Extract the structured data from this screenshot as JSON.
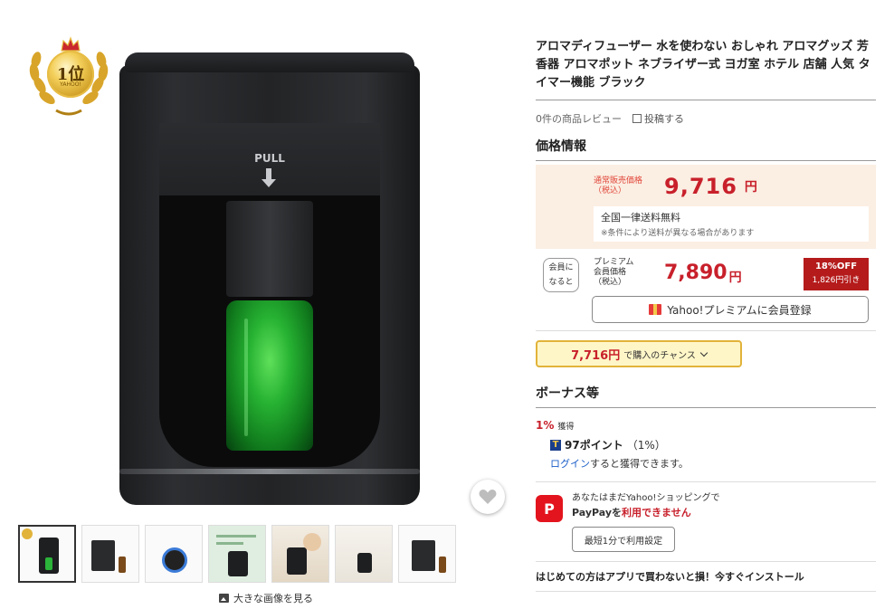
{
  "badge": {
    "rank": "1位",
    "brand": "YAHOO!"
  },
  "product_image": {
    "pull_label": "PULL"
  },
  "thumbnails": [
    "thumb-1",
    "thumb-2",
    "thumb-3",
    "thumb-4",
    "thumb-5",
    "thumb-6",
    "thumb-7"
  ],
  "large_image_link": "大きな画像を見る",
  "product": {
    "title": "アロマディフューザー 水を使わない おしゃれ アロマグッズ 芳香器 アロマポット ネブライザー式 ヨガ室 ホテル 店舗 人気 タイマー機能 ブラック",
    "review_count": "0件の商品レビュー",
    "post_review": "投稿する"
  },
  "price": {
    "section_title": "価格情報",
    "regular_label_1": "通常販売価格",
    "regular_label_2": "（税込）",
    "regular_price": "9,716",
    "yen": "円",
    "shipping_main": "全国一律送料無料",
    "shipping_note": "※条件により送料が異なる場合があります",
    "member_tag_1": "会員に",
    "member_tag_2": "なると",
    "premium_label_1": "プレミアム",
    "premium_label_2": "会員価格",
    "premium_label_3": "（税込）",
    "premium_price": "7,890",
    "premium_yen": "円",
    "off_percent": "18%OFF",
    "off_amount": "1,826円引き",
    "premium_button": "Yahoo!プレミアムに会員登録",
    "chance_price": "7,716円",
    "chance_text": "で購入のチャンス"
  },
  "bonus": {
    "section_title": "ボーナス等",
    "percent": "1%",
    "percent_label": "獲得",
    "t_icon": "T",
    "points": "97ポイント",
    "points_rate": "（1%）",
    "login_link": "ログイン",
    "login_rest": "すると獲得できます。"
  },
  "paypay": {
    "icon_letter": "P",
    "line1": "あなたはまだYahoo!ショッピングで",
    "line2_a": "PayPayを",
    "line2_b": "利用できません",
    "button": "最短1分で利用設定"
  },
  "app_promo": "はじめての方はアプリで買わないと損！今すぐインストール",
  "colors": {
    "price_red": "#c8202b",
    "price_bg": "#fbeee2",
    "chance_border": "#e2b33a",
    "link_blue": "#1a5ec8"
  }
}
